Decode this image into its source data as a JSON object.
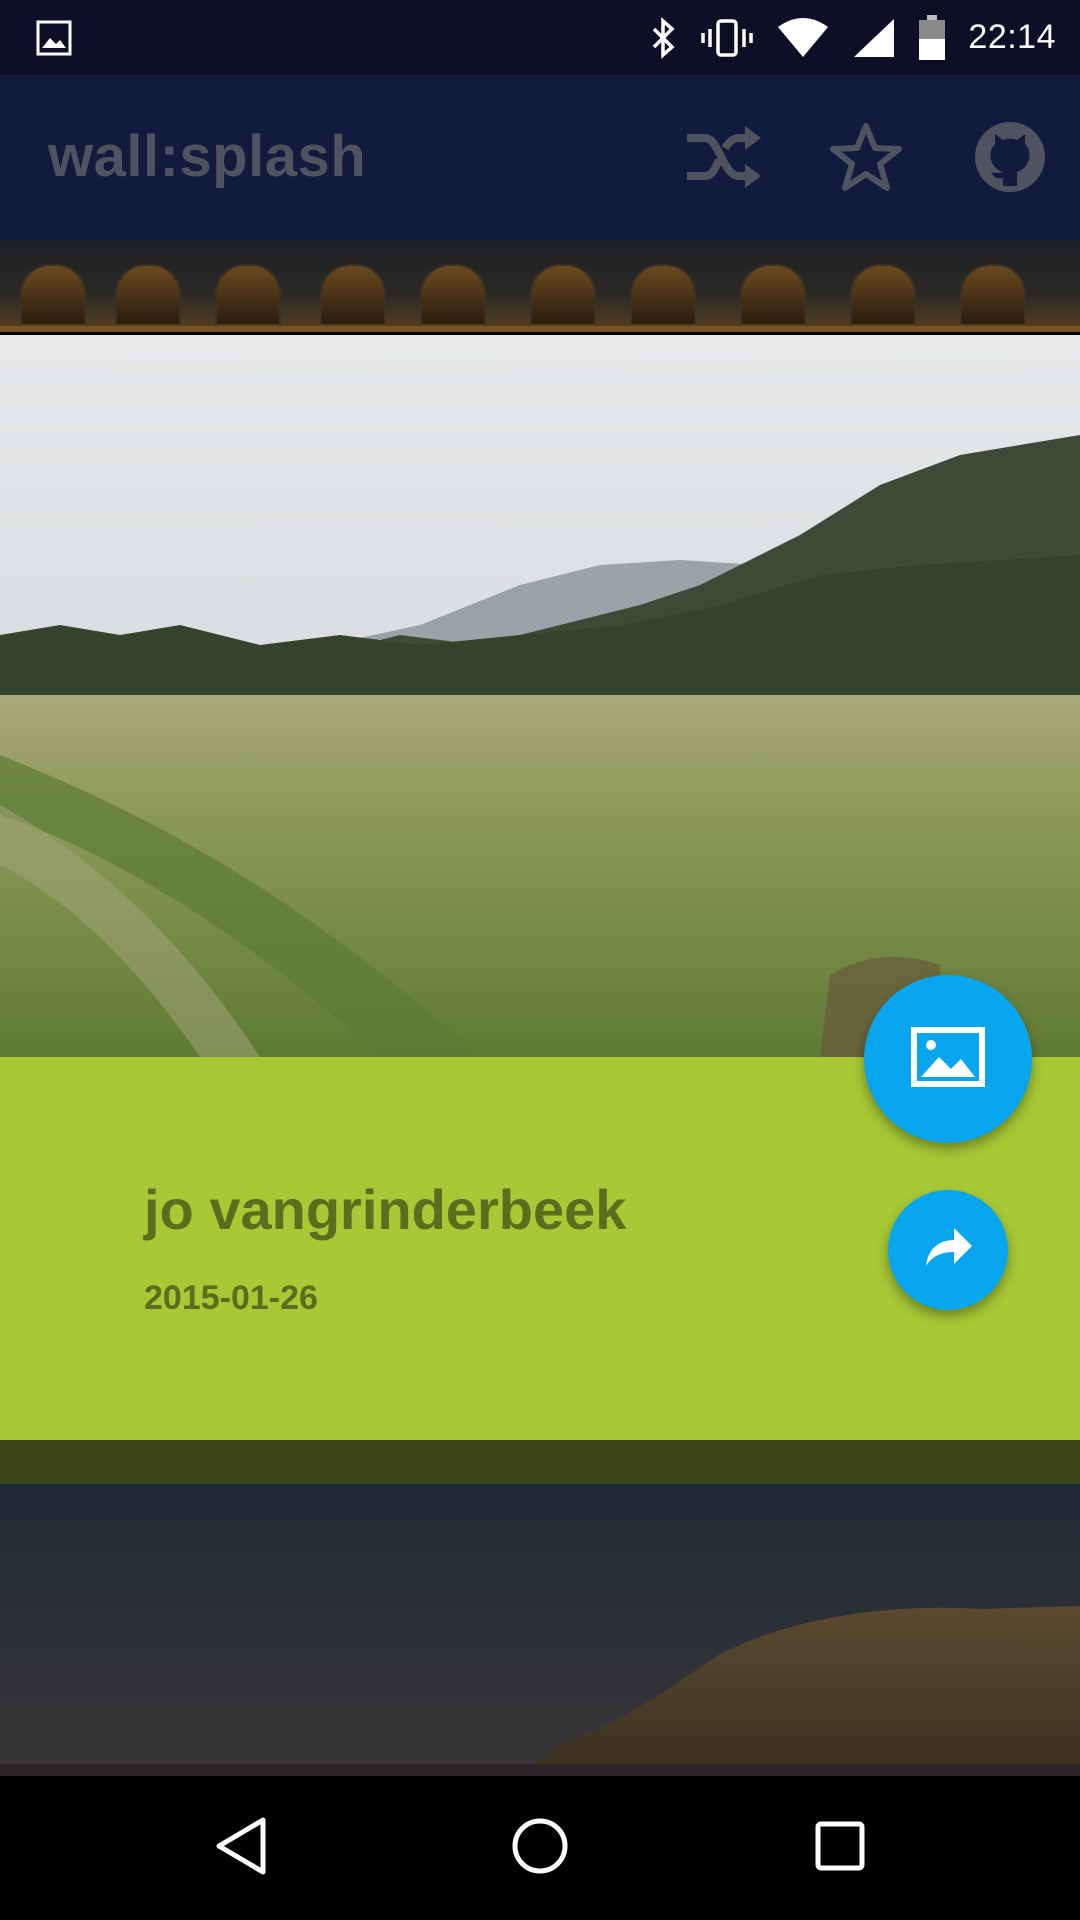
{
  "status_bar": {
    "time": "22:14",
    "left_icon": "image-icon",
    "icons": [
      "bluetooth-icon",
      "vibrate-icon",
      "wifi-icon",
      "cell-signal-icon",
      "battery-icon"
    ]
  },
  "app_bar": {
    "title": "wall:splash",
    "actions": [
      "shuffle-icon",
      "star-outline-icon",
      "github-icon"
    ]
  },
  "card": {
    "author": "jo vangrinderbeek",
    "date": "2015-01-26",
    "panel_color": "#a8c935",
    "text_color": "#5a6e1d",
    "fab_color": "#09a6f0",
    "fab_primary_icon": "image-icon",
    "fab_secondary_icon": "share-icon"
  },
  "nav_bar": {
    "buttons": [
      "back-icon",
      "home-icon",
      "recents-icon"
    ]
  },
  "colors": {
    "status_bar": "#0e0f26",
    "app_bar": "#121a3d",
    "app_title": "#4f5360"
  }
}
